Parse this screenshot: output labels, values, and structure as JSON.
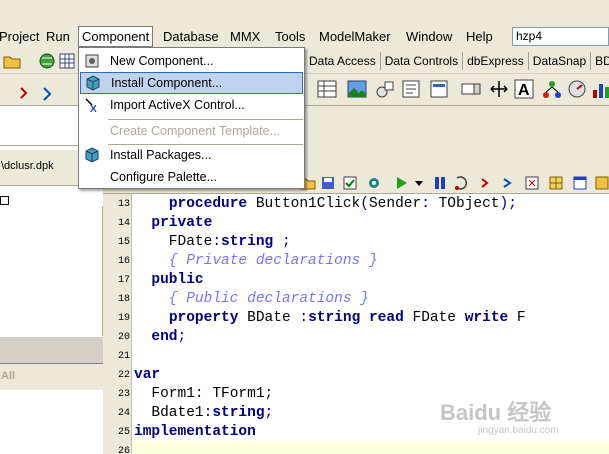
{
  "menubar": {
    "items": [
      "Project",
      "Run",
      "Component",
      "Database",
      "MMX",
      "Tools",
      "ModelMaker",
      "Window",
      "Help"
    ],
    "search_value": "hzp4"
  },
  "palette_tabs": [
    "Data Access",
    "Data Controls",
    "dbExpress",
    "DataSnap",
    "BDE"
  ],
  "component_menu": {
    "items": [
      {
        "label": "New Component...",
        "icon": "new-component-icon",
        "enabled": true
      },
      {
        "label": "Install Component...",
        "icon": "install-component-icon",
        "enabled": true,
        "highlighted": true
      },
      {
        "label": "Import ActiveX Control...",
        "icon": "activex-icon",
        "enabled": true
      },
      {
        "label": "Create Component Template...",
        "icon": "",
        "enabled": false
      },
      {
        "label": "Install Packages...",
        "icon": "packages-icon",
        "enabled": true
      },
      {
        "label": "Configure Palette...",
        "icon": "",
        "enabled": true
      }
    ]
  },
  "left": {
    "dpk_file": "\\dclusr.dpk",
    "all_label": "All"
  },
  "editor": {
    "line_numbers": [
      "13",
      "14",
      "15",
      "16",
      "17",
      "18",
      "19",
      "20",
      "21",
      "22",
      "23",
      "24",
      "25",
      "26"
    ],
    "lines": [
      "    procedure Button1Click(Sender: TObject);",
      "  private",
      "    FDate:string ;",
      "    { Private declarations }",
      "  public",
      "    { Public declarations }",
      "    property BDate :string read FDate write F",
      "  end;",
      "",
      "var",
      "  Form1: TForm1;",
      "  Bdate1:string;",
      "implementation",
      ""
    ]
  },
  "watermark": {
    "text": "Baidu 经验",
    "sub": "jingyan.baidu.com"
  },
  "colors": {
    "highlight": "#c1d2ee",
    "highlight_border": "#316ac5",
    "keyword": "#000080",
    "comment": "#0000ff"
  }
}
